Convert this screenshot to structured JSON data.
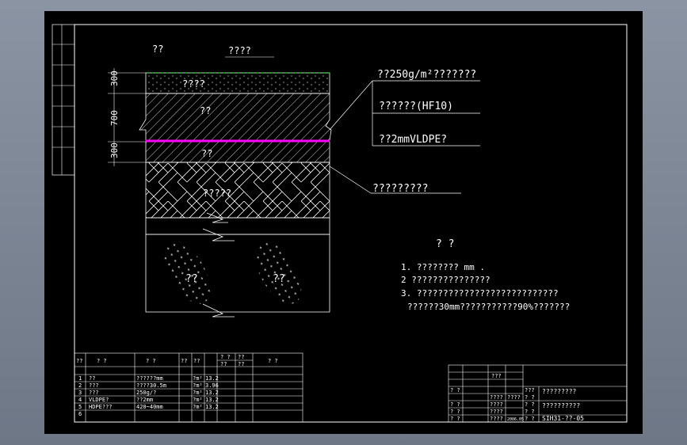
{
  "drawing": {
    "layer_labels": {
      "vegetation": "??",
      "vegetation_layer": "????",
      "topsoil": "????",
      "fill1": "??",
      "fill2": "??",
      "drain": "?????",
      "waste1": "??",
      "waste2": "??"
    },
    "dimensions": [
      "300",
      "700",
      "300"
    ],
    "callouts": [
      "??250g/m²???????",
      "??????(HF10)",
      "??2mmVLDPE?",
      "?????????"
    ],
    "colors": {
      "accent": "#ff00ff",
      "green": "#00ff00",
      "line": "#ffffff"
    }
  },
  "notes": {
    "title": "? ?",
    "items": [
      "1. ???????? mm .",
      "2  ???????????????",
      "3. ???????????????????????????",
      "??????30mm???????????90%???????"
    ]
  },
  "materials_table": {
    "headers": [
      "??",
      "?  ?",
      "?   ?",
      "??",
      "??",
      "?  ?",
      "??",
      "?  ?"
    ],
    "subheaders": [
      "??",
      "??"
    ],
    "rows": [
      [
        "1",
        "??",
        "??????mm",
        "?m²",
        "13.2"
      ],
      [
        "2",
        "???",
        "????30.5m",
        "?m²",
        "3.96"
      ],
      [
        "3",
        "???",
        "250g/?",
        "?m²",
        "13.2"
      ],
      [
        "4",
        "VLDPE?",
        "??2mm",
        "?m²",
        "13.2"
      ],
      [
        "5",
        "HDPE???",
        "420~40mm",
        "?m²",
        "13.2"
      ],
      [
        "6",
        "",
        "",
        "",
        ""
      ]
    ]
  },
  "title_block": {
    "cells": [
      "???",
      "???",
      "?????????",
      "? ?",
      "? ?",
      "??????????",
      "? ?",
      "? ?",
      "? ?"
    ],
    "drawing_number": "SIH31-??-05",
    "left_labels": [
      "? ?",
      "? ?",
      "? ?",
      "? ?"
    ],
    "mid_labels": [
      "????",
      "????",
      "????",
      "????",
      "????",
      "2006.05"
    ]
  }
}
